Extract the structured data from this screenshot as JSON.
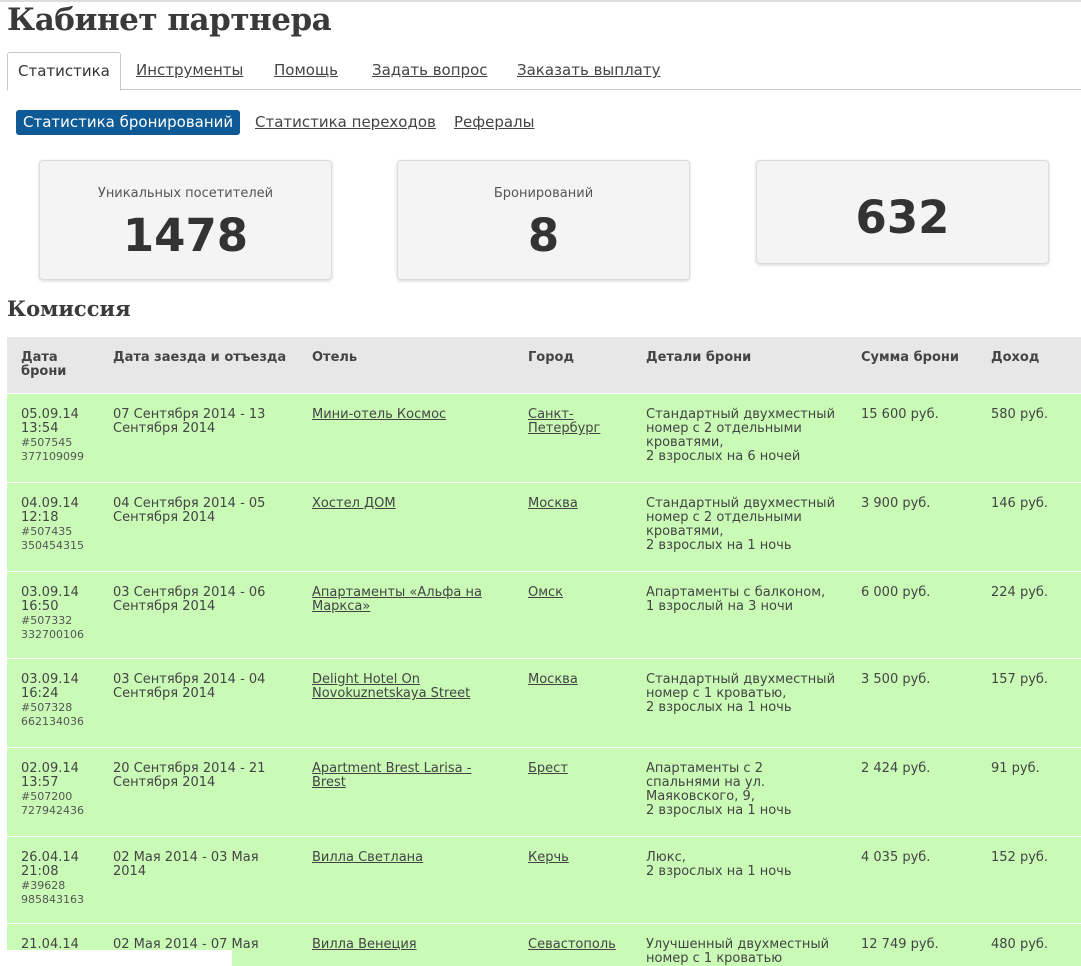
{
  "page": {
    "title": "Кабинет партнера",
    "section_title": "Комиссия"
  },
  "tabs": [
    {
      "label": "Статистика",
      "active": true
    },
    {
      "label": "Инструменты"
    },
    {
      "label": "Помощь"
    },
    {
      "label": "Задать вопрос"
    },
    {
      "label": "Заказать выплату"
    }
  ],
  "subtabs": [
    {
      "label": "Статистика бронирований",
      "active": true
    },
    {
      "label": "Статистика переходов"
    },
    {
      "label": "Рефералы"
    }
  ],
  "stats": [
    {
      "label": "Уникальных посетителей",
      "value": "1478"
    },
    {
      "label": "Бронирований",
      "value": "8"
    },
    {
      "label": "",
      "value": "632"
    }
  ],
  "colors": {
    "accent": "#0d5a96",
    "row_bg": "#c9fbb7",
    "header_bg": "#e7e7e7"
  },
  "table": {
    "headers": [
      "Дата брони",
      "Дата заезда и отъезда",
      "Отель",
      "Город",
      "Детали брони",
      "Сумма брони",
      "Доход"
    ],
    "rows": [
      {
        "date": "05.09.14 13:54",
        "id": "#507545 377109099",
        "dates": "07 Сентября 2014 - 13 Сентября 2014",
        "hotel": "Мини-отель Космос",
        "city": "Санкт-Петербург",
        "details": [
          "Стандартный двухместный номер с 2 отдельными кроватями,",
          "2 взрослых на 6 ночей"
        ],
        "sum": "15 600 руб.",
        "income": "580 руб."
      },
      {
        "date": "04.09.14 12:18",
        "id": "#507435 350454315",
        "dates": "04 Сентября 2014 - 05 Сентября 2014",
        "hotel": "Хостел ДОМ",
        "city": "Москва",
        "details": [
          "Стандартный двухместный номер с 2 отдельными кроватями,",
          "2 взрослых на 1 ночь"
        ],
        "sum": "3 900 руб.",
        "income": "146 руб."
      },
      {
        "date": "03.09.14 16:50",
        "id": "#507332 332700106",
        "dates": "03 Сентября 2014 - 06 Сентября 2014",
        "hotel": "Апартаменты «Альфа на Маркса»",
        "city": "Омск",
        "details": [
          "Апартаменты с балконом,",
          "1 взрослый на 3 ночи"
        ],
        "sum": "6 000 руб.",
        "income": "224 руб."
      },
      {
        "date": "03.09.14 16:24",
        "id": "#507328 662134036",
        "dates": "03 Сентября 2014 - 04 Сентября 2014",
        "hotel": "Delight Hotel On Novokuznetskaya Street",
        "city": "Москва",
        "details": [
          "Стандартный двухместный номер с 1 кроватью,",
          "2 взрослых на 1 ночь"
        ],
        "sum": "3 500 руб.",
        "income": "157 руб."
      },
      {
        "date": "02.09.14 13:57",
        "id": "#507200 727942436",
        "dates": "20 Сентября 2014 - 21 Сентября 2014",
        "hotel": "Apartment Brest Larisa - Brest",
        "city": "Брест",
        "details": [
          "Апартаменты с 2 спальнями на ул. Маяковского, 9,",
          "2 взрослых на 1 ночь"
        ],
        "sum": "2 424 руб.",
        "income": "91 руб."
      },
      {
        "date": "26.04.14 21:08",
        "id": "#39628 985843163",
        "dates": "02 Мая 2014 - 03 Мая 2014",
        "hotel": "Вилла Светлана",
        "city": "Керчь",
        "details": [
          "Люкс,",
          "2 взрослых на 1 ночь"
        ],
        "sum": "4 035 руб.",
        "income": "152 руб."
      },
      {
        "date": "21.04.14",
        "id": "",
        "dates": "02 Мая 2014 - 07 Мая",
        "hotel": "Вилла Венеция",
        "city": "Севастополь",
        "details": [
          "Улучшенный двухместный номер с 1 кроватью"
        ],
        "sum": "12 749 руб.",
        "income": "480 руб."
      }
    ]
  }
}
